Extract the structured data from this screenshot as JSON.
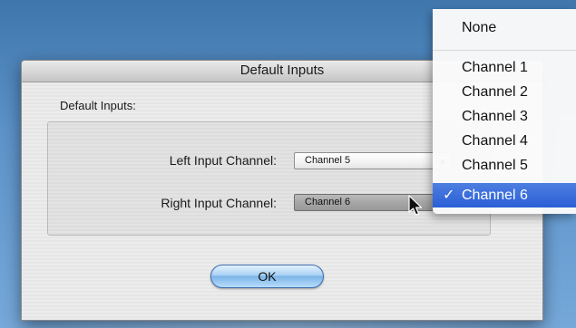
{
  "window": {
    "title": "Default Inputs"
  },
  "group": {
    "label": "Default Inputs:"
  },
  "fields": {
    "left": {
      "label": "Left Input Channel:",
      "value": "Channel 5"
    },
    "right": {
      "label": "Right Input Channel:",
      "value": "Channel 6"
    }
  },
  "buttons": {
    "ok": "OK"
  },
  "menu": {
    "items": [
      {
        "label": "None",
        "checked": false
      },
      {
        "label": "Channel 1",
        "checked": false
      },
      {
        "label": "Channel 2",
        "checked": false
      },
      {
        "label": "Channel 3",
        "checked": false
      },
      {
        "label": "Channel 4",
        "checked": false
      },
      {
        "label": "Channel 5",
        "checked": false
      },
      {
        "label": "Channel 6",
        "checked": true
      }
    ],
    "check_glyph": "✓"
  },
  "colors": {
    "desktop": "#5c92c8",
    "menu_highlight": "#2a5fd6",
    "ok_button": "#7bb4e8"
  }
}
